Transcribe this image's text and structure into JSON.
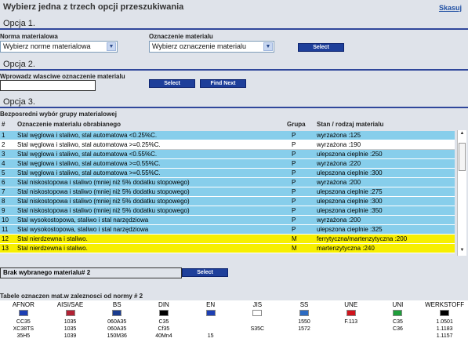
{
  "header": {
    "title": "Wybierz jedna z trzech opcji przeszukiwania",
    "skip_link": "Skasuj"
  },
  "option1": {
    "heading": "Opcja 1.",
    "norm_label": "Norma materialowa",
    "norm_value": "Wybierz norme materialowa",
    "designation_label": "Oznaczenie materialu",
    "designation_value": "Wybierz oznaczenie materialu",
    "select_button": "Select"
  },
  "option2": {
    "heading": "Opcja 2.",
    "input_label": "Wprowadz wlasciwe oznaczenie materialu",
    "input_value": "",
    "select_button": "Select",
    "find_next_button": "Find Next"
  },
  "option3": {
    "heading": "Opcja 3.",
    "subheading": "Bezposredni wybór grupy materialowej",
    "columns": {
      "num": "#",
      "designation": "Oznaczenie materialu obrabianego",
      "group": "Grupa",
      "state": "Stan / rodzaj materialu"
    },
    "rows": [
      {
        "num": "1",
        "designation": "Stal węglowa i staliwo, stal automatowa <0.25%C.",
        "group": "P",
        "state": "wyrzażona   :125",
        "color": "blue"
      },
      {
        "num": "2",
        "designation": "Stal węglowa i staliwo, stal automatowa >=0.25%C.",
        "group": "P",
        "state": "wyrzażona   :190",
        "color": "white"
      },
      {
        "num": "3",
        "designation": "Stal węglowa i staliwo, stal automatowa <0.55%C.",
        "group": "P",
        "state": "ulepszona cieplnie   :250",
        "color": "blue"
      },
      {
        "num": "4",
        "designation": "Stal węglowa i staliwo, stal automatowa >=0.55%C.",
        "group": "P",
        "state": "wyrzażona   :220",
        "color": "blue"
      },
      {
        "num": "5",
        "designation": "Stal węglowa i staliwo, stal automatowa >=0.55%C.",
        "group": "P",
        "state": "ulepszona cieplnie   :300",
        "color": "blue"
      },
      {
        "num": "6",
        "designation": "Stal niskostopowa i staliwo (mniej niż 5% dodatku stopowego)",
        "group": "P",
        "state": "wyrzażona   :200",
        "color": "blue"
      },
      {
        "num": "7",
        "designation": "Stal niskostopowa i staliwo (mniej niż 5% dodatku stopowego)",
        "group": "P",
        "state": "ulepszona cieplnie   :275",
        "color": "blue"
      },
      {
        "num": "8",
        "designation": "Stal niskostopowa i staliwo (mniej niż 5% dodatku stopowego)",
        "group": "P",
        "state": "ulepszona cieplnie   :300",
        "color": "blue"
      },
      {
        "num": "9",
        "designation": "Stal niskostopowa i staliwo (mniej niż 5% dodatku stopowego)",
        "group": "P",
        "state": "ulepszona cieplnie   :350",
        "color": "blue"
      },
      {
        "num": "10",
        "designation": "Stal wysokostopowa, staliwo i stal narzędziowa",
        "group": "P",
        "state": "wyrzażona   :200",
        "color": "blue"
      },
      {
        "num": "11",
        "designation": "Stal wysokostopowa, staliwo i stal narzędziowa",
        "group": "P",
        "state": "ulepszona cieplnie   :325",
        "color": "blue"
      },
      {
        "num": "12",
        "designation": "Stal nierdzewna i staliwo.",
        "group": "M",
        "state": "ferrytyczna/martenzytyczna   :200",
        "color": "yellow"
      },
      {
        "num": "13",
        "designation": "Stal nierdzewna i staliwo.",
        "group": "M",
        "state": "martenzytyczna   :240",
        "color": "yellow"
      }
    ]
  },
  "selection": {
    "status": "Brak wybranego materialu# 2",
    "select_button": "Select"
  },
  "equivalents": {
    "heading": "Tabele oznaczen mat.w zaleznosci od normy # 2",
    "standards": [
      "AFNOR",
      "AISI/SAE",
      "BS",
      "DIN",
      "EN",
      "JIS",
      "SS",
      "UNE",
      "UNI",
      "WERKSTOFF"
    ],
    "flag_colors": [
      "#1d3fb3",
      "#b22234",
      "#1a3c8f",
      "#000000",
      "#1d3fb3",
      "#ffffff",
      "#2c6bc2",
      "#d0141d",
      "#1e9e3a",
      "#000000"
    ],
    "rows": [
      [
        "CC35",
        "1035",
        "060A35",
        "C35",
        "",
        "",
        "1550",
        "F.113",
        "C35",
        "1.0501"
      ],
      [
        "XC38TS",
        "1035",
        "060A35",
        "Cf35",
        "",
        "S35C",
        "1572",
        "",
        "C36",
        "1.1183"
      ],
      [
        "35H5",
        "1039",
        "150M36",
        "40Mn4",
        "15",
        "",
        "",
        "",
        "",
        "1.1157"
      ]
    ]
  }
}
